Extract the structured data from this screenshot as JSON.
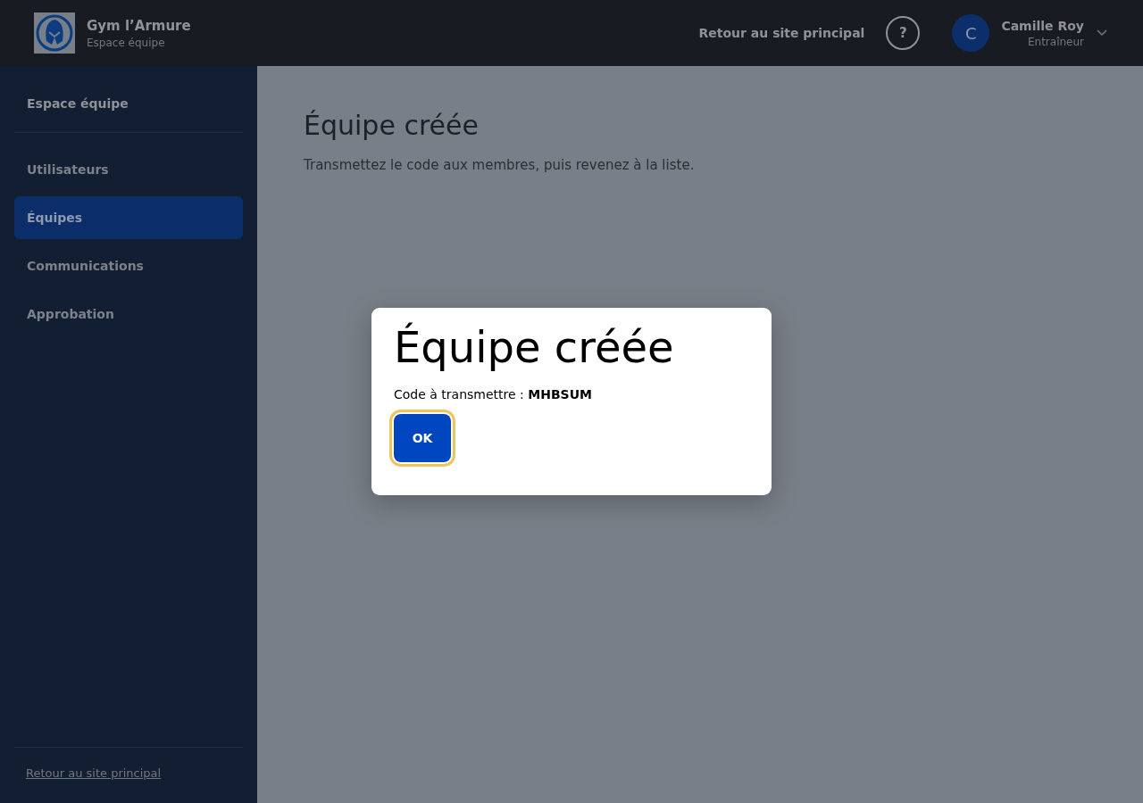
{
  "header": {
    "brand": "Gym l’Armure",
    "subtitle": "Espace équipe",
    "back_link": "Retour au site principal",
    "help": "?",
    "user": {
      "initial": "C",
      "name": "Camille Roy",
      "role": "Entraîneur"
    }
  },
  "sidebar": {
    "title": "Espace équipe",
    "items": [
      {
        "label": "Utilisateurs",
        "selected": false
      },
      {
        "label": "Équipes",
        "selected": true
      },
      {
        "label": "Communications",
        "selected": false
      },
      {
        "label": "Approbation",
        "selected": false
      }
    ],
    "footer_link": "Retour au site principal"
  },
  "page": {
    "title": "Équipe créée",
    "description": "Transmettez le code aux membres, puis revenez à la liste."
  },
  "dialog": {
    "title": "Équipe créée",
    "message": "Code à transmettre : **MHBSUM**",
    "button": {
      "label": "OK",
      "focused": true
    }
  }
}
